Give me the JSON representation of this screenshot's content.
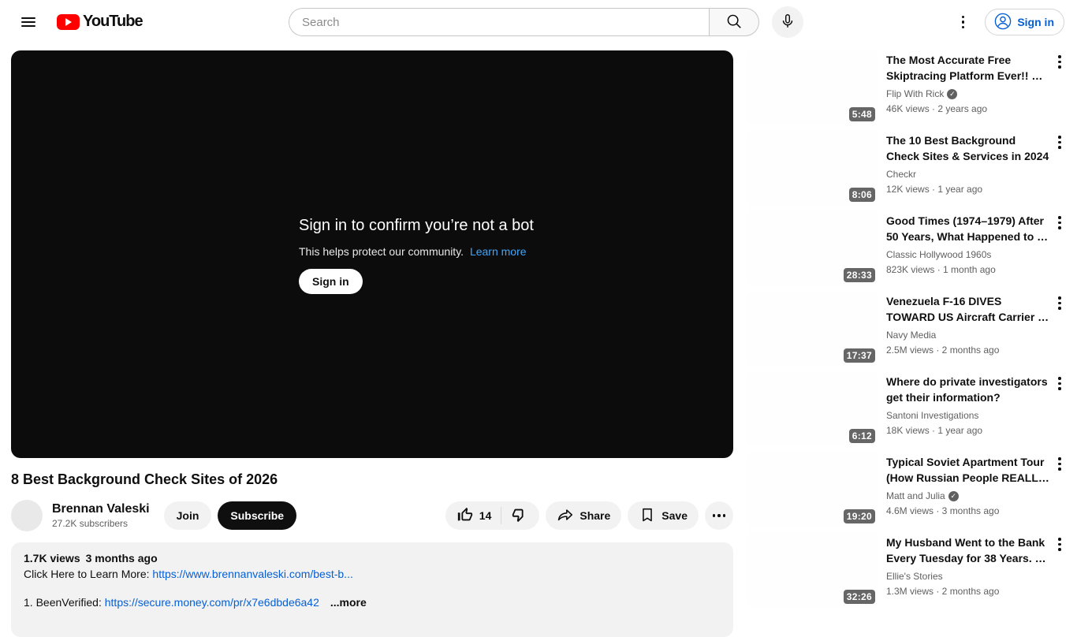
{
  "colors": {
    "brand_red": "#ff0000",
    "link_blue": "#065fd4",
    "player_link_blue": "#3ea6ff",
    "badge_bg": "rgba(0,0,0,0.6)",
    "subscribe_bg": "#0f0f0f"
  },
  "header": {
    "logo_text": "YouTube",
    "search_placeholder": "Search",
    "signin_label": "Sign in"
  },
  "player": {
    "overlay_title": "Sign in to confirm you’re not a bot",
    "overlay_subtitle": "This helps protect our community.",
    "overlay_link": "Learn more",
    "overlay_button": "Sign in"
  },
  "video": {
    "title": "8 Best Background Check Sites of 2026",
    "channel": "Brennan Valeski",
    "subscribers": "27.2K subscribers",
    "join_label": "Join",
    "subscribe_label": "Subscribe",
    "like_count": "14",
    "share_label": "Share",
    "save_label": "Save"
  },
  "description": {
    "views": "1.7K views",
    "date": "3 months ago",
    "line1_label": "Click Here to Learn More: ",
    "line1_link": "https://www.brennanvaleski.com/best-b...",
    "line2_label": "1. BeenVerified: ",
    "line2_link": "https://secure.money.com/pr/x7e6dbde6a42",
    "more_label": "...more"
  },
  "sidebar": {
    "videos": [
      {
        "title": "The Most Accurate Free Skiptracing Platform Ever!! …",
        "channel": "Flip With Rick",
        "verified": true,
        "meta": "46K views · 2 years ago",
        "duration": "5:48"
      },
      {
        "title": "The 10 Best Background Check Sites & Services in 2024",
        "channel": "Checkr",
        "verified": false,
        "meta": "12K views · 1 year ago",
        "duration": "8:06"
      },
      {
        "title": "Good Times (1974–1979) After 50 Years, What Happened to …",
        "channel": "Classic Hollywood 1960s",
        "verified": false,
        "meta": "823K views · 1 month ago",
        "duration": "28:33"
      },
      {
        "title": "Venezuela F-16 DIVES TOWARD US Aircraft Carrier …",
        "channel": "Navy Media",
        "verified": false,
        "meta": "2.5M views · 2 months ago",
        "duration": "17:37"
      },
      {
        "title": "Where do private investigators get their information?",
        "channel": "Santoni Investigations",
        "verified": false,
        "meta": "18K views · 1 year ago",
        "duration": "6:12"
      },
      {
        "title": "Typical Soviet Apartment Tour (How Russian People REALL…",
        "channel": "Matt and Julia",
        "verified": true,
        "meta": "4.6M views · 3 months ago",
        "duration": "19:20"
      },
      {
        "title": "My Husband Went to the Bank Every Tuesday for 38 Years. …",
        "channel": "Ellie's Stories",
        "verified": false,
        "meta": "1.3M views · 2 months ago",
        "duration": "32:26"
      }
    ]
  }
}
